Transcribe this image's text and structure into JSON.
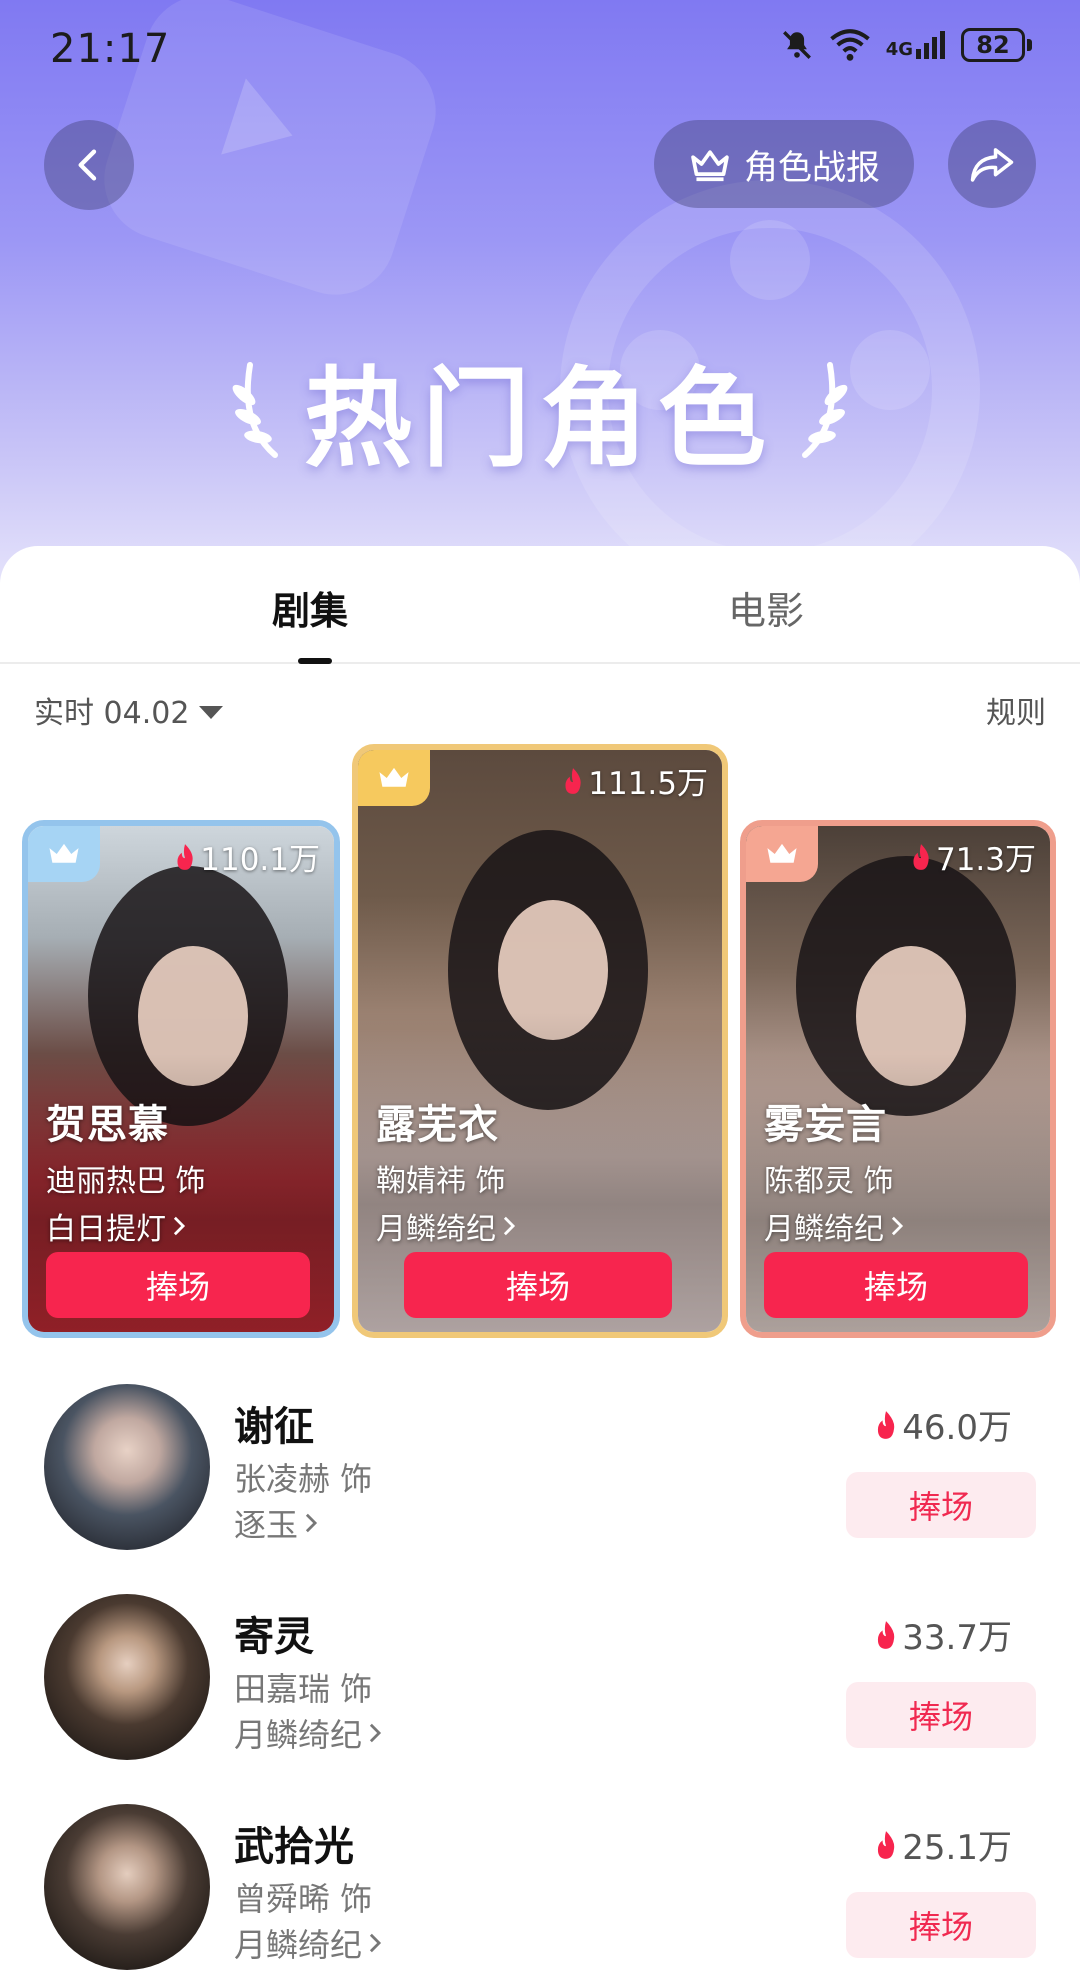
{
  "status_bar": {
    "time": "21:17",
    "network": "4G",
    "battery": "82",
    "icons": [
      "bell-muted-icon",
      "wifi-icon",
      "signal-icon",
      "battery-icon"
    ]
  },
  "nav": {
    "back_icon": "chevron-left-icon",
    "report_label": "角色战报",
    "report_icon": "crown-icon",
    "share_icon": "share-icon"
  },
  "hero": {
    "title": "热门角色"
  },
  "tabs": [
    {
      "label": "剧集",
      "active": true
    },
    {
      "label": "电影",
      "active": false
    }
  ],
  "filter": {
    "date": "实时 04.02",
    "rules": "规则"
  },
  "top3": [
    {
      "rank": 2,
      "heat": "110.1万",
      "role": "贺思慕",
      "actor": "迪丽热巴 饰",
      "show": "白日提灯",
      "button": "捧场",
      "badge_color": "#a6d4f4"
    },
    {
      "rank": 1,
      "heat": "111.5万",
      "role": "露芜衣",
      "actor": "鞠婧祎 饰",
      "show": "月鳞绮纪",
      "button": "捧场",
      "badge_color": "#f6c95e"
    },
    {
      "rank": 3,
      "heat": "71.3万",
      "role": "雾妄言",
      "actor": "陈都灵 饰",
      "show": "月鳞绮纪",
      "button": "捧场",
      "badge_color": "#f5a692"
    }
  ],
  "list": [
    {
      "role": "谢征",
      "actor": "张凌赫 饰",
      "show": "逐玉",
      "heat": "46.0万",
      "button": "捧场"
    },
    {
      "role": "寄灵",
      "actor": "田嘉瑞 饰",
      "show": "月鳞绮纪",
      "heat": "33.7万",
      "button": "捧场"
    },
    {
      "role": "武拾光",
      "actor": "曾舜晞 饰",
      "show": "月鳞绮纪",
      "heat": "25.1万",
      "button": "捧场"
    }
  ],
  "colors": {
    "accent": "#f7254e",
    "accent_light": "#fdebef",
    "hero_top": "#8079f2"
  }
}
